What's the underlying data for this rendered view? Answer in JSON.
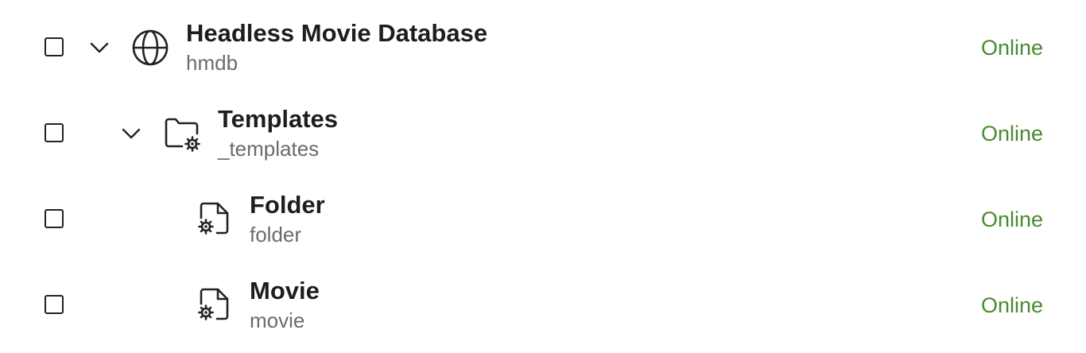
{
  "colors": {
    "status_online": "#4a8a2e",
    "icon": "#222222",
    "subtitle": "#6b6b6b"
  },
  "rows": [
    {
      "title": "Headless Movie Database",
      "subtitle": "hmdb",
      "status": "Online",
      "icon": "globe-icon",
      "expanded": true,
      "checked": false
    },
    {
      "title": "Templates",
      "subtitle": "_templates",
      "status": "Online",
      "icon": "folder-settings-icon",
      "expanded": true,
      "checked": false
    },
    {
      "title": "Folder",
      "subtitle": "folder",
      "status": "Online",
      "icon": "file-settings-icon",
      "checked": false
    },
    {
      "title": "Movie",
      "subtitle": "movie",
      "status": "Online",
      "icon": "file-settings-icon",
      "checked": false
    }
  ]
}
